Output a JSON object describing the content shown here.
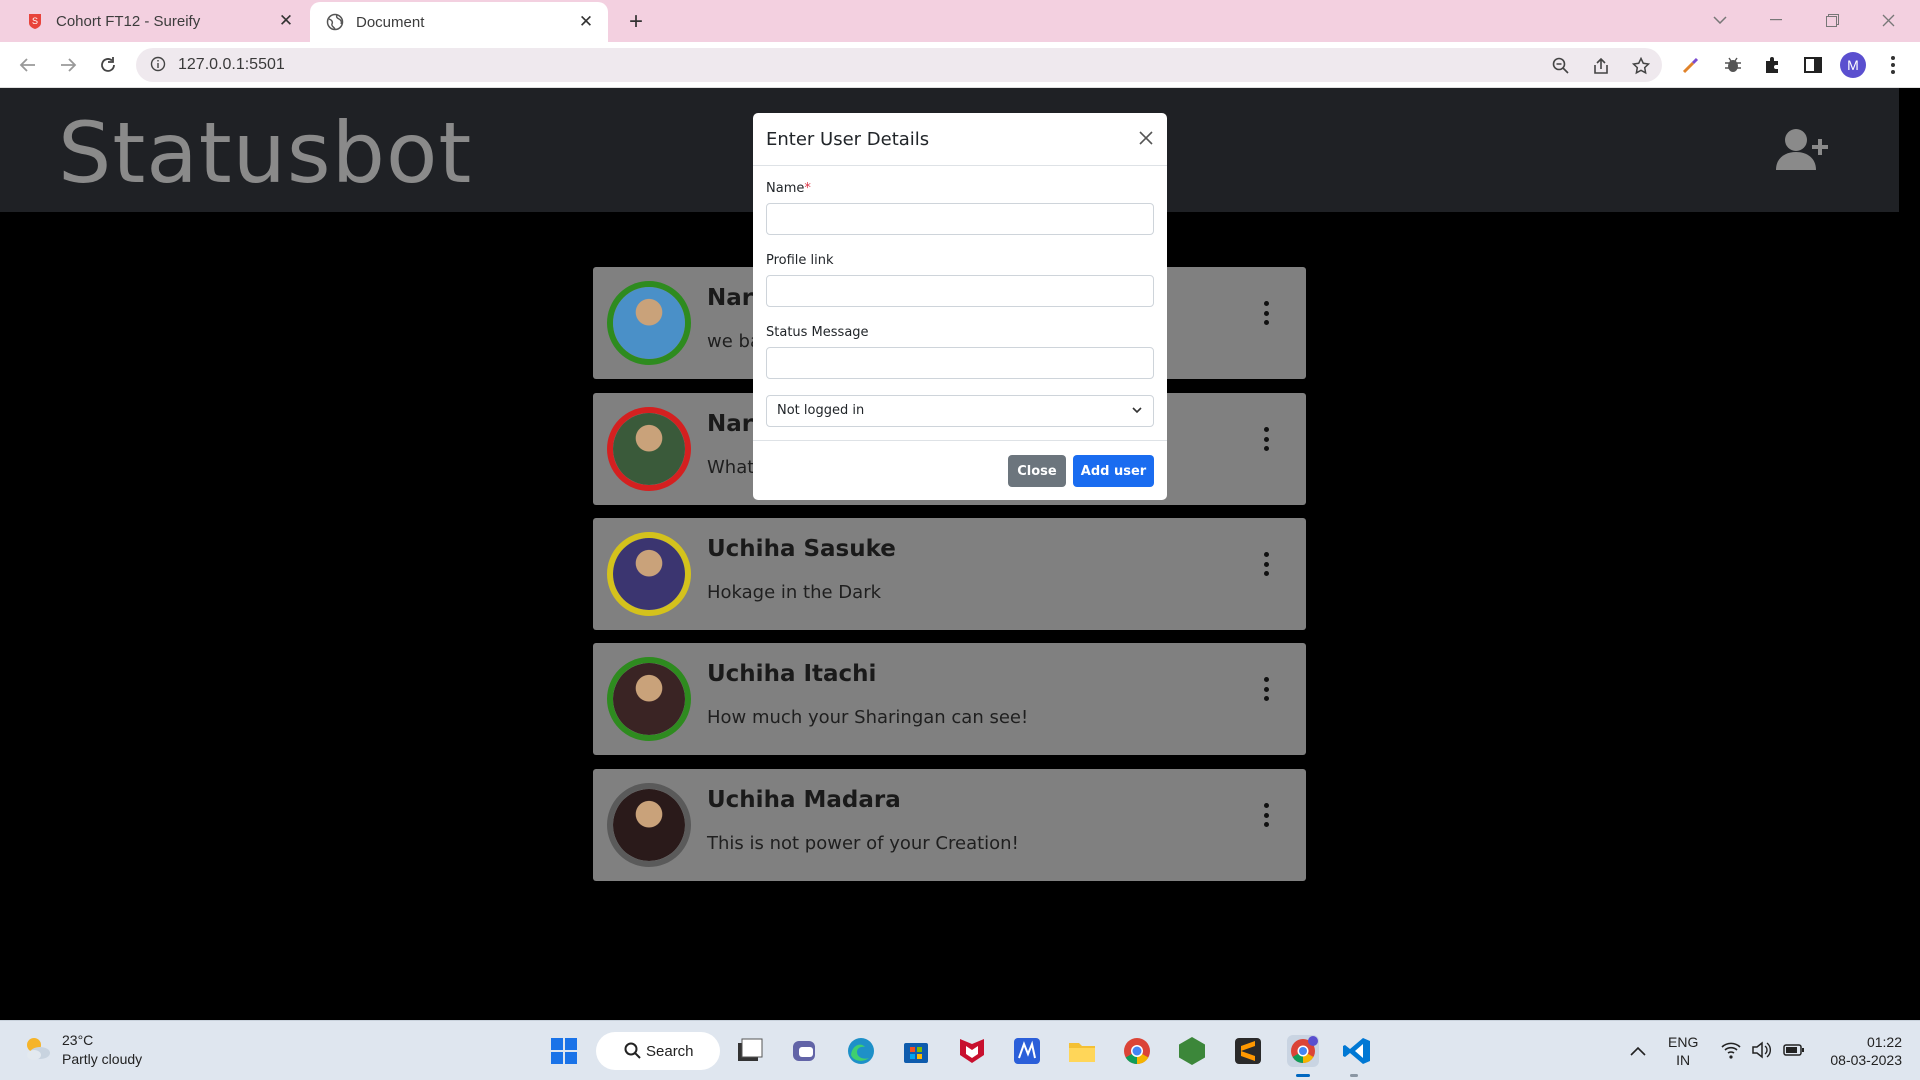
{
  "browser": {
    "tabs": [
      {
        "title": "Cohort FT12 - Sureify",
        "active": false
      },
      {
        "title": "Document",
        "active": true
      }
    ],
    "url": "127.0.0.1:5501",
    "profile_initial": "M"
  },
  "app": {
    "brand": "Statusbot"
  },
  "users": [
    {
      "name": "Naru",
      "message": "we ba",
      "ring_color": "#2e8b1f",
      "pic_color": "#4a90c8"
    },
    {
      "name": "Nara",
      "message": "What",
      "ring_color": "#d42020",
      "pic_color": "#3a5a3a"
    },
    {
      "name": "Uchiha Sasuke",
      "message": "Hokage in the Dark",
      "ring_color": "#d4c21c",
      "pic_color": "#3b3570"
    },
    {
      "name": "Uchiha Itachi",
      "message": "How much your Sharingan can see!",
      "ring_color": "#2e8b1f",
      "pic_color": "#3a2424"
    },
    {
      "name": "Uchiha Madara",
      "message": "This is not power of your Creation!",
      "ring_color": "#5a5a5a",
      "pic_color": "#2a1a1a"
    }
  ],
  "modal": {
    "title": "Enter User Details",
    "name_label": "Name",
    "required_mark": "*",
    "profile_label": "Profile link",
    "status_label": "Status Message",
    "select_value": "Not logged in",
    "close_label": "Close",
    "add_label": "Add user"
  },
  "taskbar": {
    "temperature": "23°C",
    "weather": "Partly cloudy",
    "search_label": "Search",
    "lang1": "ENG",
    "lang2": "IN",
    "time": "01:22",
    "date": "08-03-2023"
  }
}
